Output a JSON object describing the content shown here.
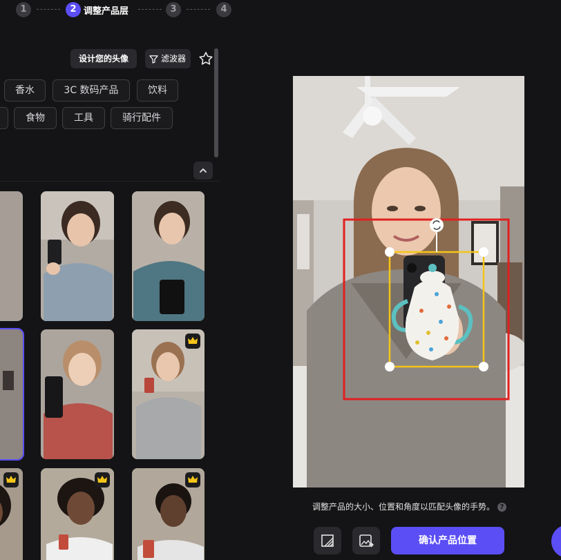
{
  "stepper": {
    "steps": [
      {
        "number": "1"
      },
      {
        "number": "2",
        "label": "调整产品层"
      },
      {
        "number": "3"
      },
      {
        "number": "4"
      }
    ]
  },
  "toolbar": {
    "design_avatar": "设计您的头像",
    "filter": "滤波器",
    "favorite_icon": "star-icon"
  },
  "categories": {
    "row1": [
      "香水",
      "3C 数码产品",
      "饮料"
    ],
    "row2": [
      "食物",
      "工具",
      "骑行配件"
    ]
  },
  "avatars": [
    {
      "row": 1,
      "premium": false,
      "holding": "phone"
    },
    {
      "row": 1,
      "premium": false,
      "holding": "phone"
    },
    {
      "row": 1,
      "premium": false,
      "holding": "box"
    },
    {
      "row": 2,
      "premium": false,
      "holding": "phone",
      "selected": true
    },
    {
      "row": 2,
      "premium": false,
      "holding": "phone"
    },
    {
      "row": 2,
      "premium": true,
      "holding": "snack"
    },
    {
      "row": 3,
      "premium": true,
      "holding": "snack"
    },
    {
      "row": 3,
      "premium": true,
      "holding": "snack"
    },
    {
      "row": 3,
      "premium": true,
      "holding": "snack"
    }
  ],
  "editor": {
    "caption": "调整产品的大小、位置和角度以匹配头像的手势。",
    "help_icon": "?",
    "confirm_button": "确认产品位置",
    "colors": {
      "accent": "#5b4ef5",
      "bounding_box": "#e02020",
      "transform_box": "#f5c518"
    }
  }
}
